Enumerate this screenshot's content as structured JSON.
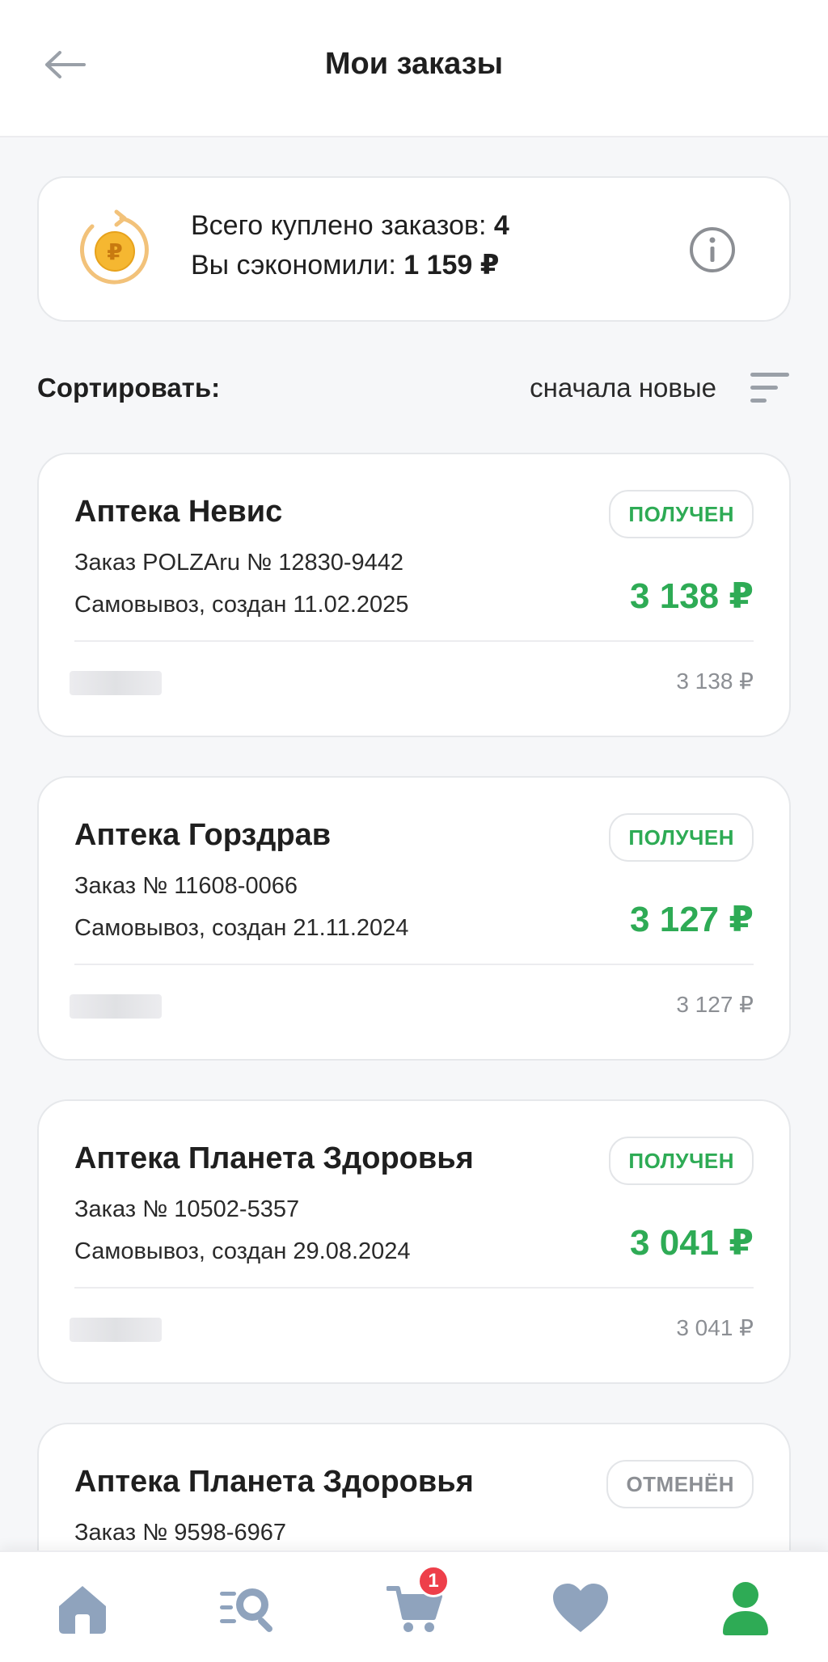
{
  "header": {
    "title": "Мои заказы"
  },
  "summary": {
    "orders_label": "Всего куплено заказов:",
    "orders_count": "4",
    "saved_label": "Вы сэкономили:",
    "saved_amount": "1 159 ₽"
  },
  "sort": {
    "label": "Сортировать:",
    "value": "сначала новые"
  },
  "orders": [
    {
      "pharmacy": "Аптека Невис",
      "status": "ПОЛУЧЕН",
      "number": "Заказ POLZAru № 12830-9442",
      "meta": "Самовывоз, создан 11.02.2025",
      "total": "3 138 ₽",
      "subtotal": "3 138 ₽"
    },
    {
      "pharmacy": "Аптека Горздрав",
      "status": "ПОЛУЧЕН",
      "number": "Заказ № 11608-0066",
      "meta": "Самовывоз, создан 21.11.2024",
      "total": "3 127 ₽",
      "subtotal": "3 127 ₽"
    },
    {
      "pharmacy": "Аптека Планета Здоровья",
      "status": "ПОЛУЧЕН",
      "number": "Заказ № 10502-5357",
      "meta": "Самовывоз, создан 29.08.2024",
      "total": "3 041 ₽",
      "subtotal": "3 041 ₽"
    },
    {
      "pharmacy": "Аптека Планета Здоровья",
      "status": "ОТМЕНЁН",
      "number": "Заказ № 9598-6967",
      "meta": "",
      "total": "",
      "subtotal": ""
    }
  ],
  "nav": {
    "items": [
      "home-icon",
      "catalog-search-icon",
      "cart-icon",
      "heart-icon",
      "profile-icon"
    ],
    "cart_badge": "1",
    "colors": {
      "inactive": "#8fa3bd",
      "active": "#2eab55"
    }
  },
  "colors": {
    "accent_green": "#2eab55",
    "muted": "#8c8f94",
    "badge_red": "#ee3f4a"
  }
}
